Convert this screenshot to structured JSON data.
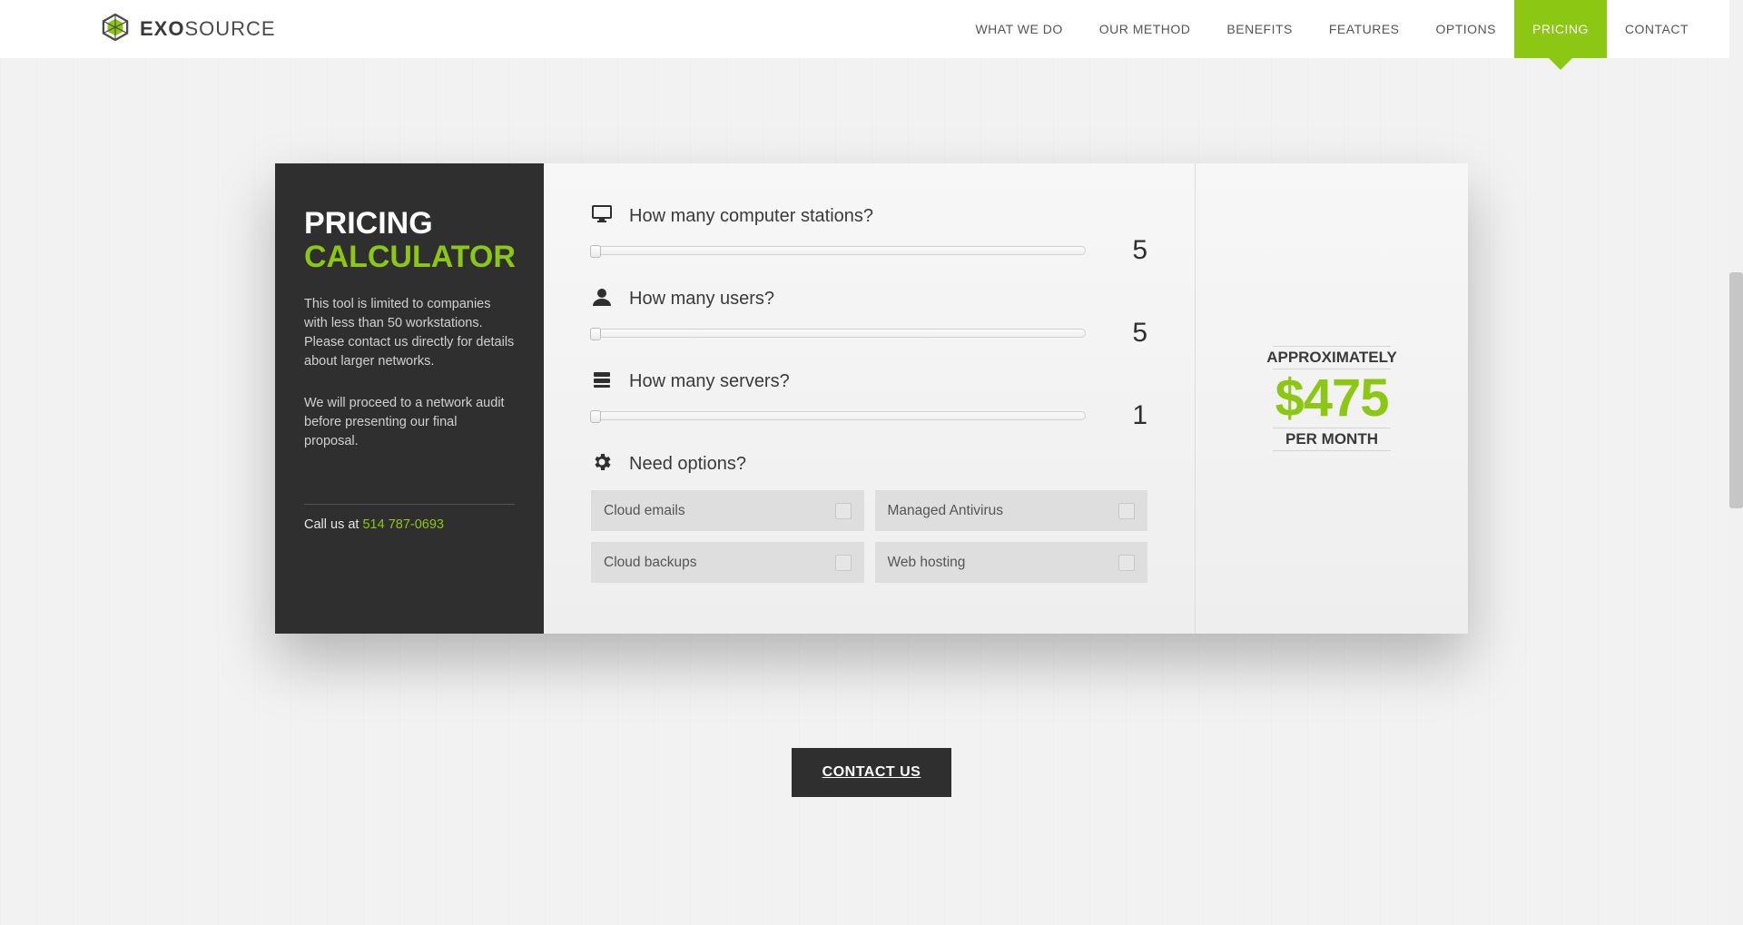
{
  "brand": {
    "bold": "EXO",
    "light": "SOURCE"
  },
  "nav": [
    {
      "id": "what-we-do",
      "label": "WHAT WE DO",
      "active": false
    },
    {
      "id": "our-method",
      "label": "OUR METHOD",
      "active": false
    },
    {
      "id": "benefits",
      "label": "BENEFITS",
      "active": false
    },
    {
      "id": "features",
      "label": "FEATURES",
      "active": false
    },
    {
      "id": "options",
      "label": "OPTIONS",
      "active": false
    },
    {
      "id": "pricing",
      "label": "PRICING",
      "active": true
    },
    {
      "id": "contact",
      "label": "CONTACT",
      "active": false
    }
  ],
  "left": {
    "title_top": "PRICING",
    "title_bottom": "CALCULATOR",
    "para1": "This tool is limited to companies with less than 50 workstations. Please contact us directly for details about larger networks.",
    "para2": "We will proceed to a network audit before presenting our final proposal.",
    "call_prefix": "Call us at ",
    "phone": "514 787-0693"
  },
  "sliders": [
    {
      "id": "stations",
      "icon": "monitor",
      "question": "How many computer stations?",
      "value": "5"
    },
    {
      "id": "users",
      "icon": "user",
      "question": "How many users?",
      "value": "5"
    },
    {
      "id": "servers",
      "icon": "server",
      "question": "How many servers?",
      "value": "1"
    }
  ],
  "options_heading": "Need options?",
  "options": [
    {
      "id": "cloud-emails",
      "label": "Cloud emails",
      "checked": false
    },
    {
      "id": "managed-antivirus",
      "label": "Managed Antivirus",
      "checked": false
    },
    {
      "id": "cloud-backups",
      "label": "Cloud backups",
      "checked": false
    },
    {
      "id": "web-hosting",
      "label": "Web hosting",
      "checked": false
    }
  ],
  "result": {
    "approx_label": "APPROXIMATELY",
    "price": "$475",
    "per_month": "PER MONTH"
  },
  "contact_button": "CONTACT US",
  "colors": {
    "accent": "#8cc714",
    "dark": "#2f2f2f"
  }
}
